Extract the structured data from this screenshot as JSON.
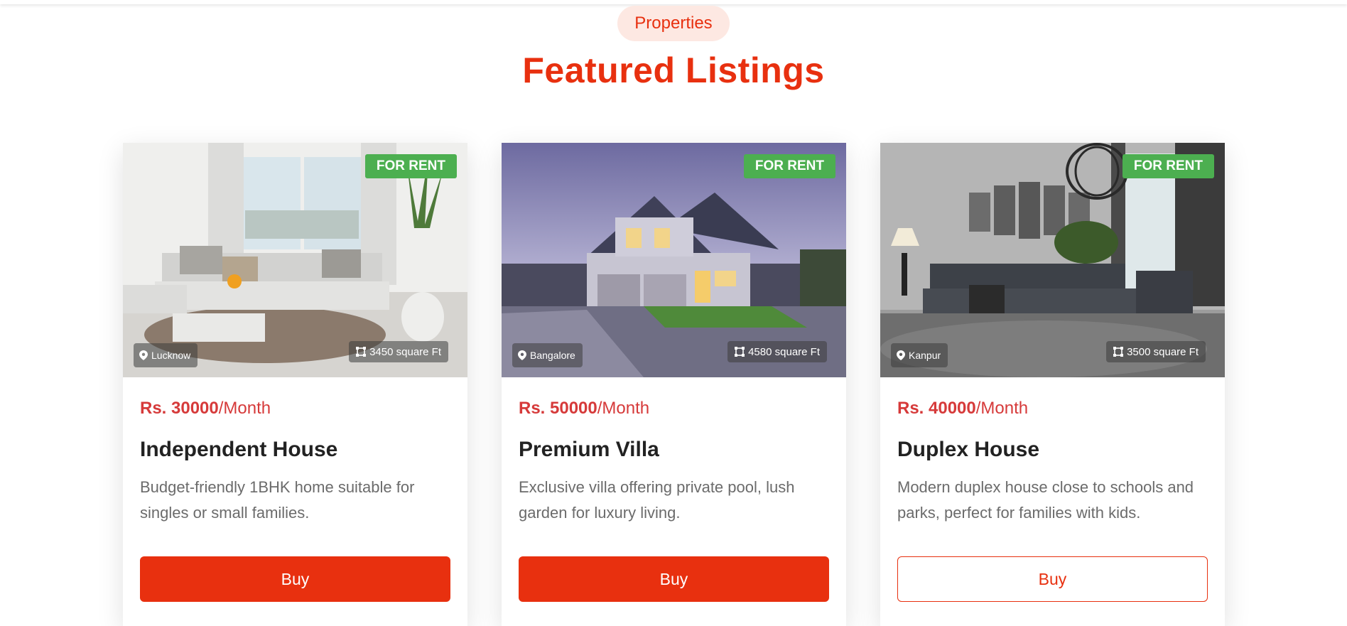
{
  "section": {
    "pill": "Properties",
    "heading": "Featured Listings"
  },
  "colors": {
    "accent": "#e8300f",
    "badge": "#4caf50",
    "price": "#d63a3a"
  },
  "cards": [
    {
      "badge": "FOR RENT",
      "location": "Lucknow",
      "area": "3450 square Ft",
      "price_amount": "Rs. 30000",
      "price_period": "/Month",
      "title": "Independent House",
      "description": "Budget-friendly 1BHK home suitable for singles or small families.",
      "button": "Buy"
    },
    {
      "badge": "FOR RENT",
      "location": "Bangalore",
      "area": "4580 square Ft",
      "price_amount": "Rs. 50000",
      "price_period": "/Month",
      "title": "Premium Villa",
      "description": "Exclusive villa offering private pool, lush garden for luxury living.",
      "button": "Buy"
    },
    {
      "badge": "FOR RENT",
      "location": "Kanpur",
      "area": "3500 square Ft",
      "price_amount": "Rs. 40000",
      "price_period": "/Month",
      "title": "Duplex House",
      "description": "Modern duplex house close to schools and parks, perfect for families with kids.",
      "button": "Buy"
    }
  ]
}
